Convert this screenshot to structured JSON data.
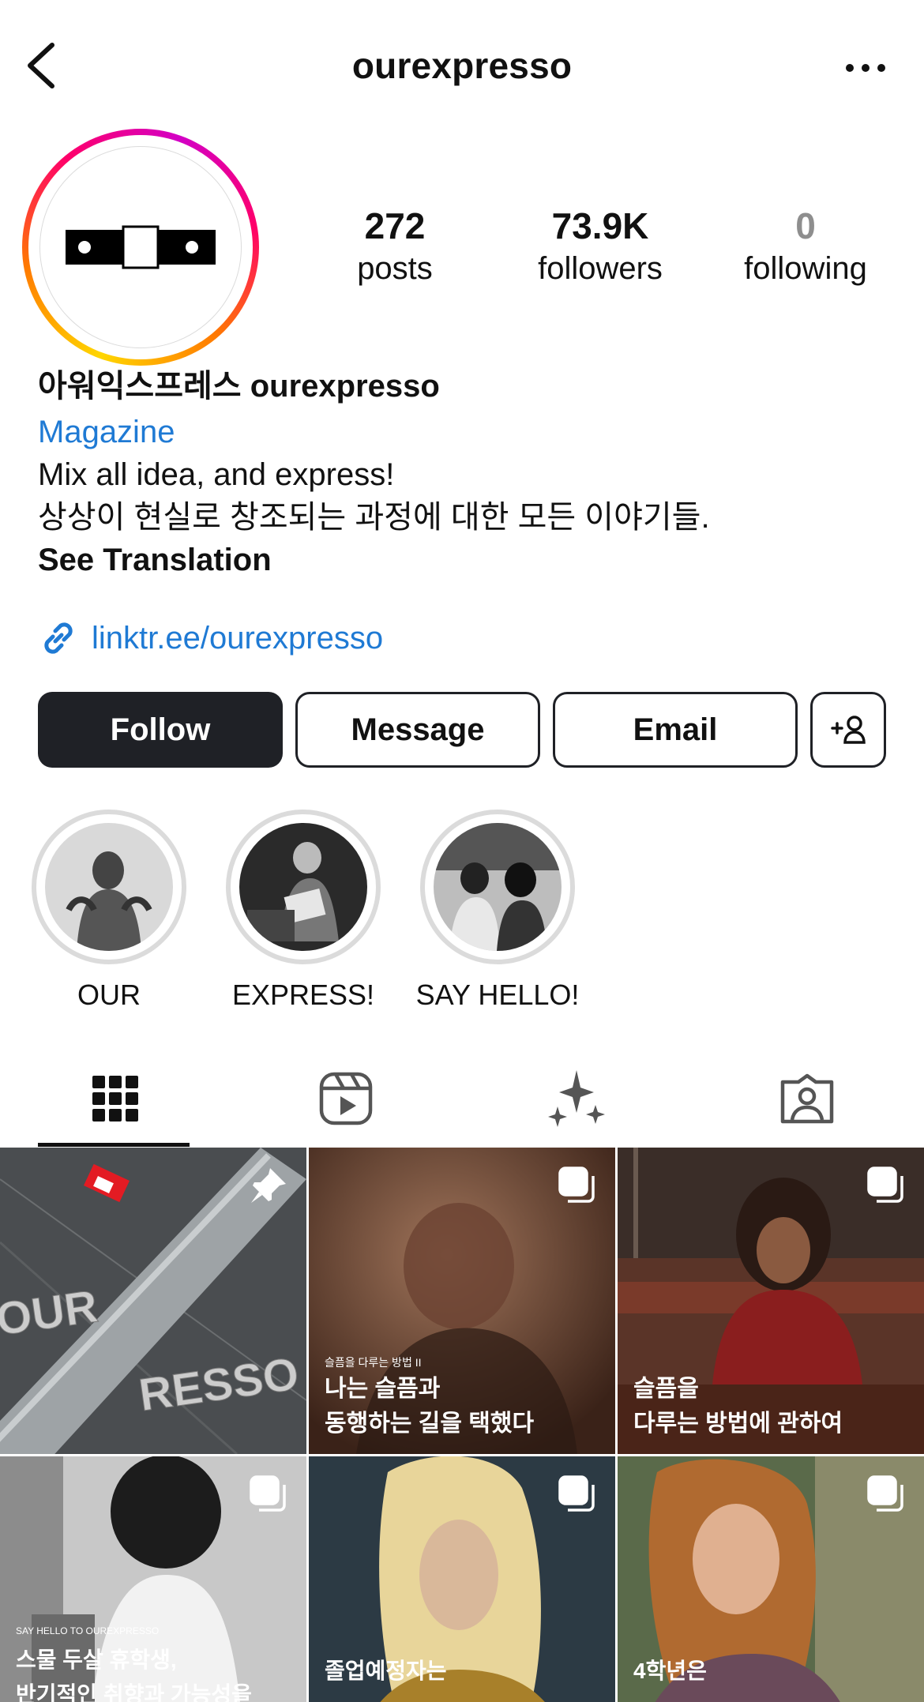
{
  "header": {
    "title": "ourexpresso"
  },
  "profile": {
    "stats": [
      {
        "value": "272",
        "label": "posts"
      },
      {
        "value": "73.9K",
        "label": "followers"
      },
      {
        "value": "0",
        "label": "following"
      }
    ],
    "display_name": "아워익스프레스 ourexpresso",
    "category": "Magazine",
    "bio_lines": [
      "Mix all idea, and express!",
      "상상이 현실로 창조되는 과정에 대한 모든 이야기들."
    ],
    "see_translation": "See Translation",
    "link": "linktr.ee/ourexpresso"
  },
  "actions": {
    "follow": "Follow",
    "message": "Message",
    "email": "Email"
  },
  "highlights": [
    {
      "label": "OUR"
    },
    {
      "label": "EXPRESS!"
    },
    {
      "label": "SAY HELLO!"
    }
  ],
  "tabs": [
    {
      "icon": "grid-icon",
      "active": true
    },
    {
      "icon": "reels-icon",
      "active": false
    },
    {
      "icon": "sparkle-icon",
      "active": false
    },
    {
      "icon": "tagged-icon",
      "active": false
    }
  ],
  "posts": [
    {
      "kicker": "",
      "title_lines": [],
      "badge": "pin-icon",
      "overlay_text": "OUREXPRESSO"
    },
    {
      "kicker": "슬픔을 다루는 방법 II",
      "title_lines": [
        "나는 슬픔과",
        "동행하는 길을 택했다"
      ],
      "badge": "carousel-icon"
    },
    {
      "kicker": "",
      "title_lines": [
        "슬픔을",
        "다루는 방법에 관하여"
      ],
      "badge": "carousel-icon"
    },
    {
      "kicker": "SAY HELLO TO OUREXPRESSO",
      "title_lines": [
        "스물 두살 휴학생,",
        "반기적인 취향과 가능성을"
      ],
      "badge": "carousel-icon"
    },
    {
      "kicker": "",
      "title_lines": [
        "졸업예정자는"
      ],
      "badge": "carousel-icon"
    },
    {
      "kicker": "",
      "title_lines": [
        "4학년은"
      ],
      "badge": "carousel-icon"
    }
  ],
  "colors": {
    "link": "#1f7ad4",
    "follow_bg": "#1f2126",
    "ring": [
      "#ffd600",
      "#ff0069",
      "#d300c5"
    ]
  }
}
